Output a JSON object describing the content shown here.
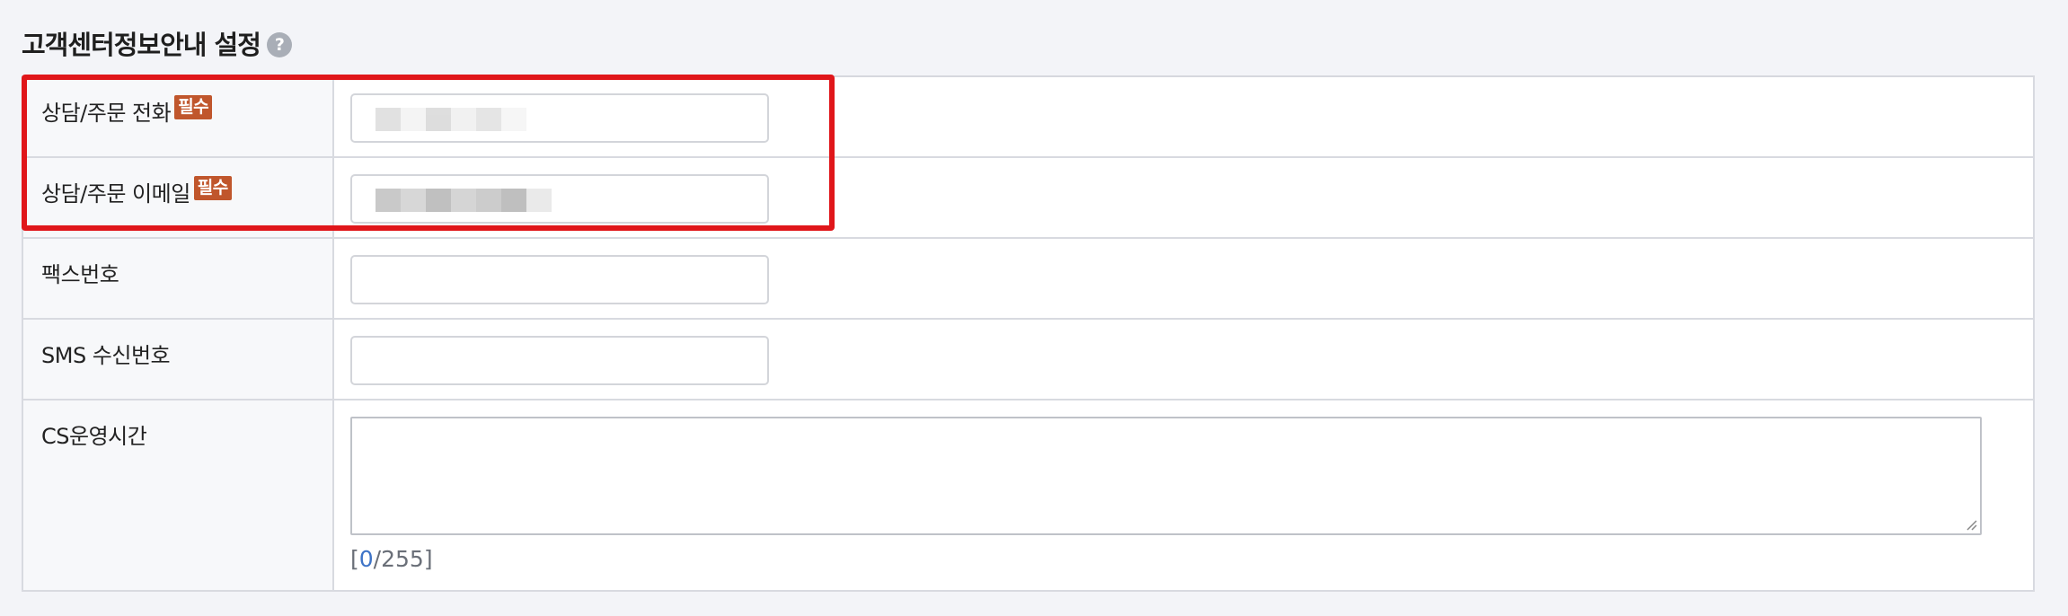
{
  "section": {
    "title": "고객센터정보안내 설정",
    "help_glyph": "?"
  },
  "form": {
    "rows": [
      {
        "label": "상담/주문 전화",
        "required": true,
        "value": ""
      },
      {
        "label": "상담/주문 이메일",
        "required": true,
        "value": ""
      },
      {
        "label": "팩스번호",
        "required": false,
        "value": ""
      },
      {
        "label": "SMS 수신번호",
        "required": false,
        "value": ""
      },
      {
        "label": "CS운영시간",
        "required": false,
        "value": ""
      }
    ],
    "required_badge": "필수",
    "counter": {
      "open": "[",
      "current": "0",
      "separator": "/",
      "max": "255",
      "close": "]"
    }
  },
  "colors": {
    "highlight": "#e0161a",
    "badge": "#c0562c",
    "counter_accent": "#3d73c7",
    "background": "#f3f4f8"
  },
  "icons": {
    "help": "question-circle-icon",
    "resize": "resize-grip-icon"
  }
}
